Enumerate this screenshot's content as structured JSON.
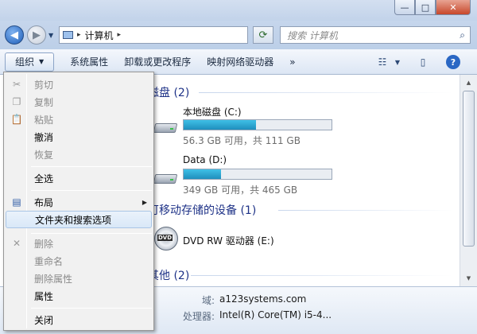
{
  "window": {
    "minimize_glyph": "—",
    "maximize_glyph": "□",
    "close_glyph": "✕"
  },
  "address": {
    "crumbs": [
      "计算机"
    ],
    "separator": "▸",
    "search_placeholder": "搜索 计算机"
  },
  "toolbar": {
    "organize_label": "组织",
    "items": [
      "系统属性",
      "卸载或更改程序",
      "映射网络驱动器"
    ],
    "more_label": "»",
    "icons": [
      "view-options-icon",
      "preview-pane-icon",
      "help-icon"
    ]
  },
  "content": {
    "hard_disks_header": "磁盘 (2)",
    "drives": [
      {
        "name": "本地磁盘 (C:)",
        "free_text": "56.3 GB 可用，共 111 GB",
        "used_fraction": 0.49
      },
      {
        "name": "Data (D:)",
        "free_text": "349 GB 可用，共 465 GB",
        "used_fraction": 0.25
      }
    ],
    "removable_header": "可移动存储的设备 (1)",
    "dvd": {
      "label": "DVD RW 驱动器 (E:)",
      "badge": "DVD"
    },
    "other_header": "其他 (2)"
  },
  "details": {
    "domain_label": "域:",
    "domain_value": "a123systems.com",
    "processor_label": "处理器:",
    "processor_value": "Intel(R) Core(TM) i5-4..."
  },
  "menu": {
    "items": [
      {
        "label": "剪切",
        "disabled": true,
        "icon": "scissors-icon"
      },
      {
        "label": "复制",
        "disabled": true,
        "icon": "copy-icon"
      },
      {
        "label": "粘贴",
        "disabled": true,
        "icon": "paste-icon"
      },
      {
        "label": "撤消",
        "disabled": false,
        "icon": ""
      },
      {
        "label": "恢复",
        "disabled": true,
        "icon": ""
      },
      {
        "label": "全选",
        "disabled": false,
        "icon": ""
      },
      {
        "label": "布局",
        "disabled": false,
        "icon": "layout-icon",
        "submenu": true
      },
      {
        "label": "文件夹和搜索选项",
        "disabled": false,
        "icon": "",
        "highlighted": true
      },
      {
        "label": "删除",
        "disabled": true,
        "icon": "delete-icon"
      },
      {
        "label": "重命名",
        "disabled": true,
        "icon": ""
      },
      {
        "label": "删除属性",
        "disabled": true,
        "icon": ""
      },
      {
        "label": "属性",
        "disabled": false,
        "icon": ""
      },
      {
        "label": "关闭",
        "disabled": false,
        "icon": ""
      }
    ]
  }
}
